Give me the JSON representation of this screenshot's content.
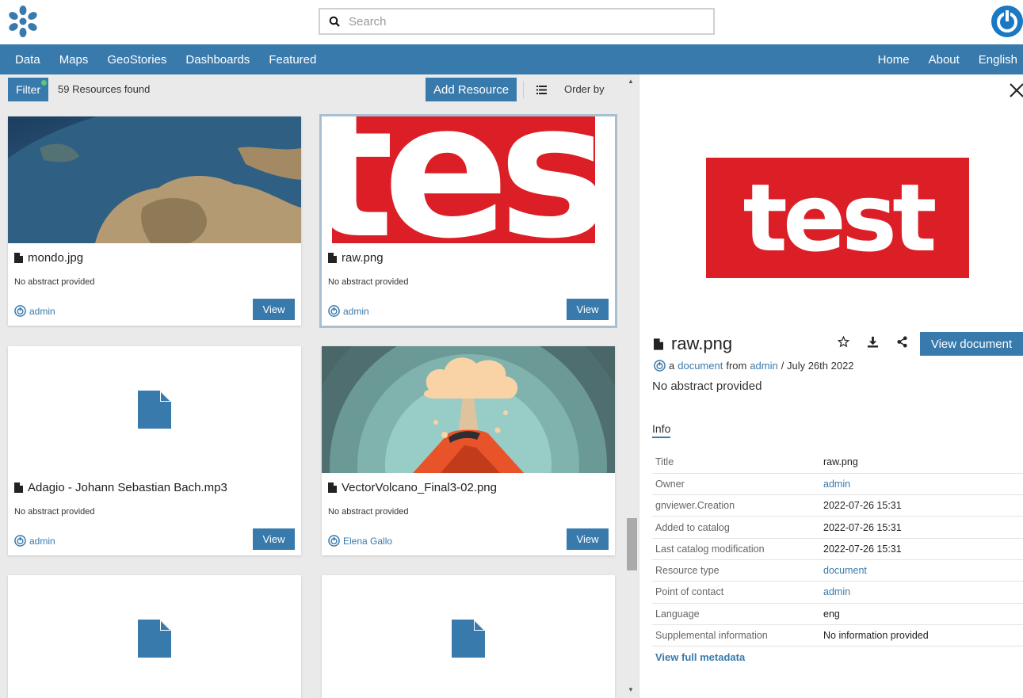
{
  "search": {
    "placeholder": "Search"
  },
  "nav": {
    "left": [
      "Data",
      "Maps",
      "GeoStories",
      "Dashboards",
      "Featured"
    ],
    "right": [
      "Home",
      "About",
      "English"
    ]
  },
  "toolbar": {
    "filter_label": "Filter",
    "found_text": "59 Resources found",
    "add_label": "Add Resource",
    "order_label": "Order by"
  },
  "cards": [
    {
      "title": "mondo.jpg",
      "abstract": "No abstract provided",
      "owner": "admin",
      "view": "View"
    },
    {
      "title": "raw.png",
      "abstract": "No abstract provided",
      "owner": "admin",
      "view": "View"
    },
    {
      "title": "Adagio - Johann Sebastian Bach.mp3",
      "abstract": "No abstract provided",
      "owner": "admin",
      "view": "View"
    },
    {
      "title": "VectorVolcano_Final3-02.png",
      "abstract": "No abstract provided",
      "owner": "Elena Gallo",
      "view": "View"
    }
  ],
  "thumb_text": "test",
  "detail": {
    "preview_text": "test",
    "title": "raw.png",
    "view_doc": "View document",
    "by_a": "a",
    "by_type": "document",
    "by_from": "from",
    "by_owner": "admin",
    "by_date": "/ July 26th 2022",
    "abstract": "No abstract provided",
    "info_tab": "Info",
    "info": [
      {
        "k": "Title",
        "v": "raw.png"
      },
      {
        "k": "Owner",
        "v": "admin"
      },
      {
        "k": "gnviewer.Creation",
        "v": "2022-07-26 15:31"
      },
      {
        "k": "Added to catalog",
        "v": "2022-07-26 15:31"
      },
      {
        "k": "Last catalog modification",
        "v": "2022-07-26 15:31"
      },
      {
        "k": "Resource type",
        "v": "document"
      },
      {
        "k": "Point of contact",
        "v": "admin"
      },
      {
        "k": "Language",
        "v": "eng"
      },
      {
        "k": "Supplemental information",
        "v": "No information provided"
      }
    ],
    "full_meta": "View full metadata"
  },
  "colors": {
    "brand": "#397aac",
    "test_red": "#dc1f26"
  }
}
